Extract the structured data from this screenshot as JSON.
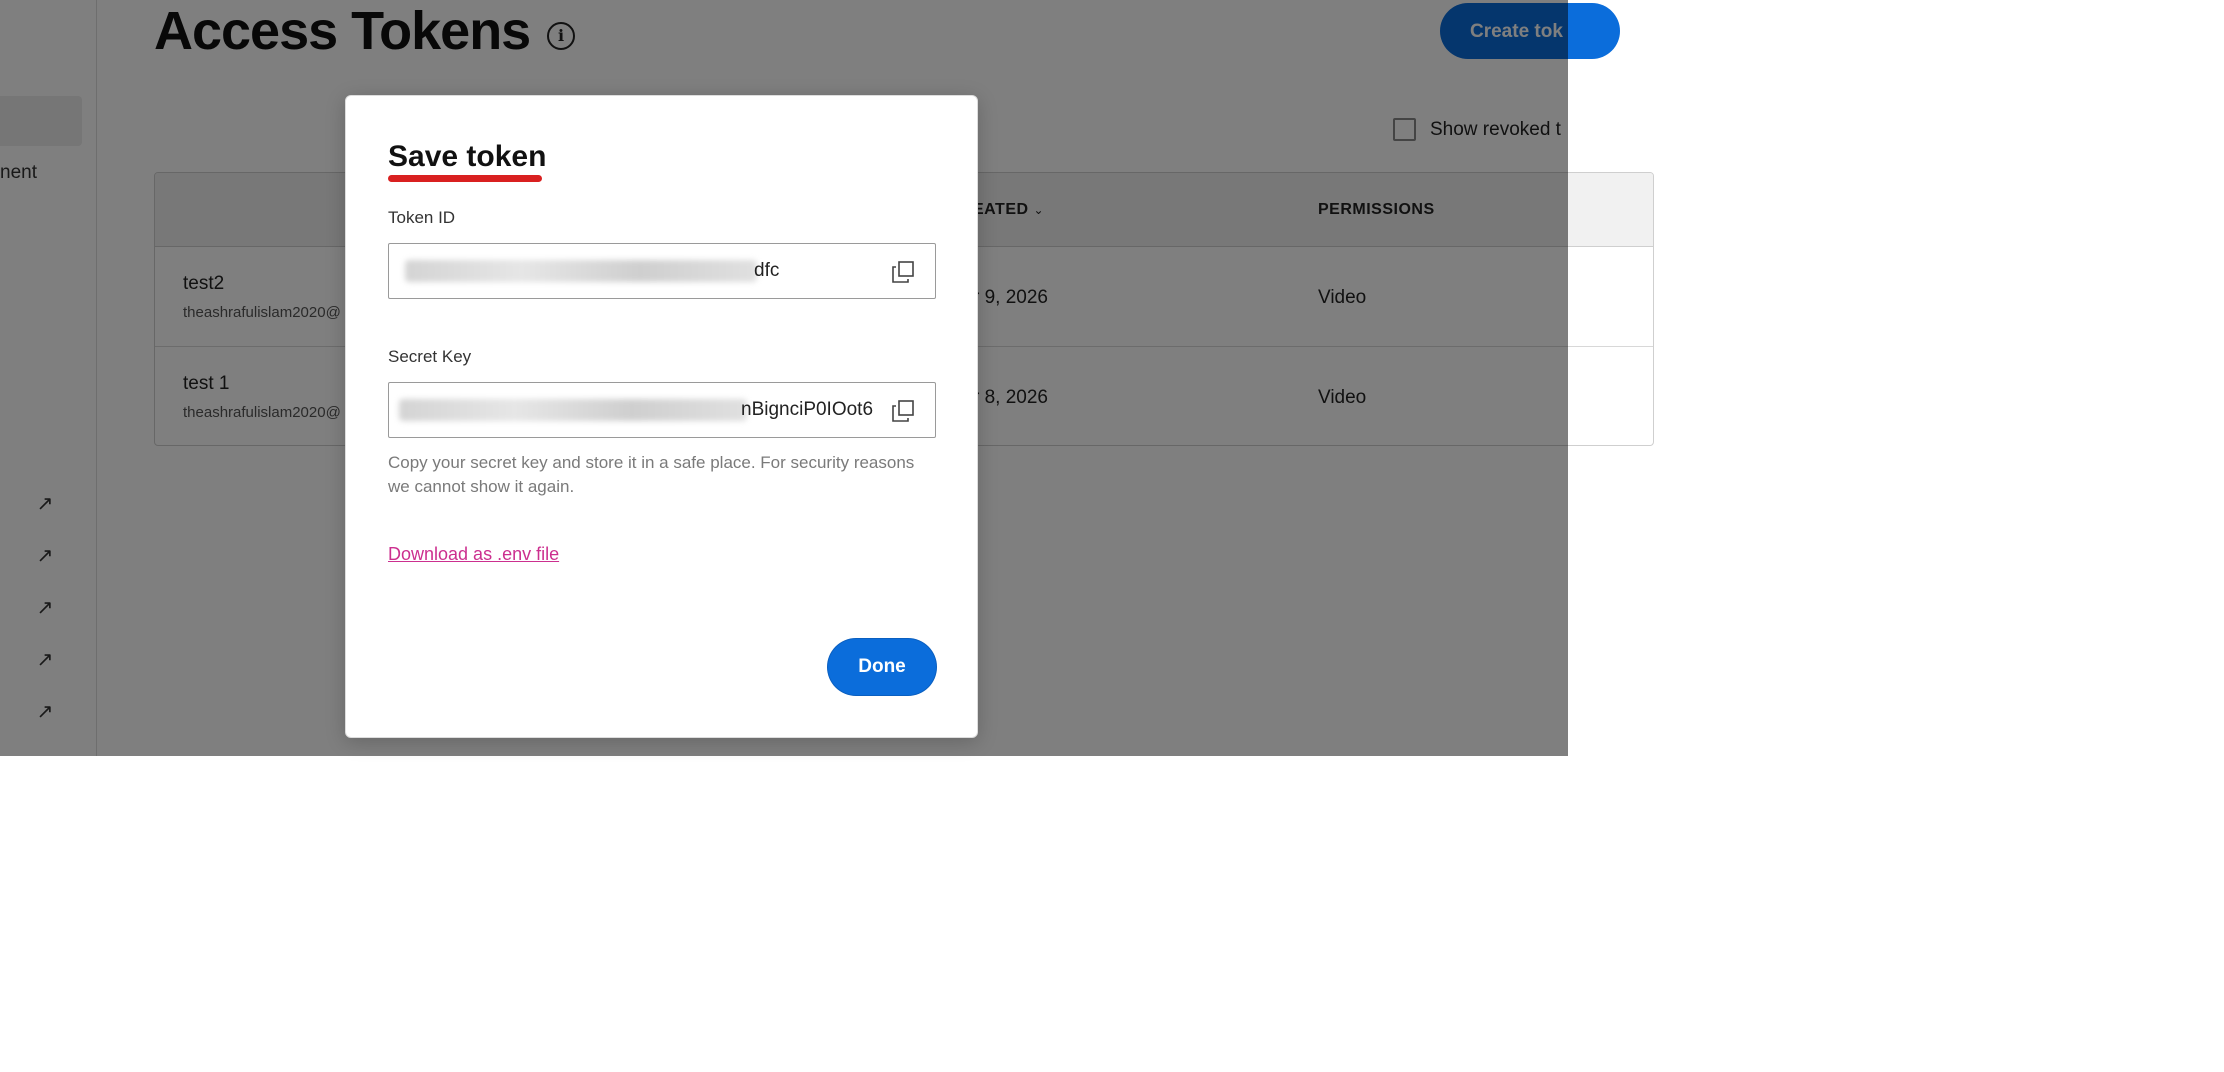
{
  "sidebar": {
    "partial_item_label": "nent",
    "external_links": [
      "arrow-up-right-icon",
      "arrow-up-right-icon",
      "arrow-up-right-icon",
      "arrow-up-right-icon",
      "arrow-up-right-icon"
    ]
  },
  "header": {
    "title": "Access Tokens",
    "create_button_label": "Create tok"
  },
  "filters": {
    "show_revoked_label": "Show revoked t"
  },
  "table": {
    "columns": [
      "EATED",
      "PERMISSIONS"
    ],
    "rows": [
      {
        "name": "test2",
        "email": "theashrafulislam2020@",
        "created": "r 9, 2026",
        "permissions": "Video"
      },
      {
        "name": "test 1",
        "email": "theashrafulislam2020@",
        "created": "r 8, 2026",
        "permissions": "Video"
      }
    ]
  },
  "modal": {
    "title": "Save token",
    "token_id_label": "Token ID",
    "token_id_visible_suffix": "dfc",
    "secret_key_label": "Secret Key",
    "secret_key_visible_suffix": "nBignciP0IOot6",
    "help_text": "Copy your secret key and store it in a safe place. For security reasons we cannot show it again.",
    "download_link": "Download as .env file",
    "done_label": "Done"
  },
  "colors": {
    "accent": "#0b6ddb",
    "title_underline": "#d92020",
    "link": "#cc2f8f"
  }
}
